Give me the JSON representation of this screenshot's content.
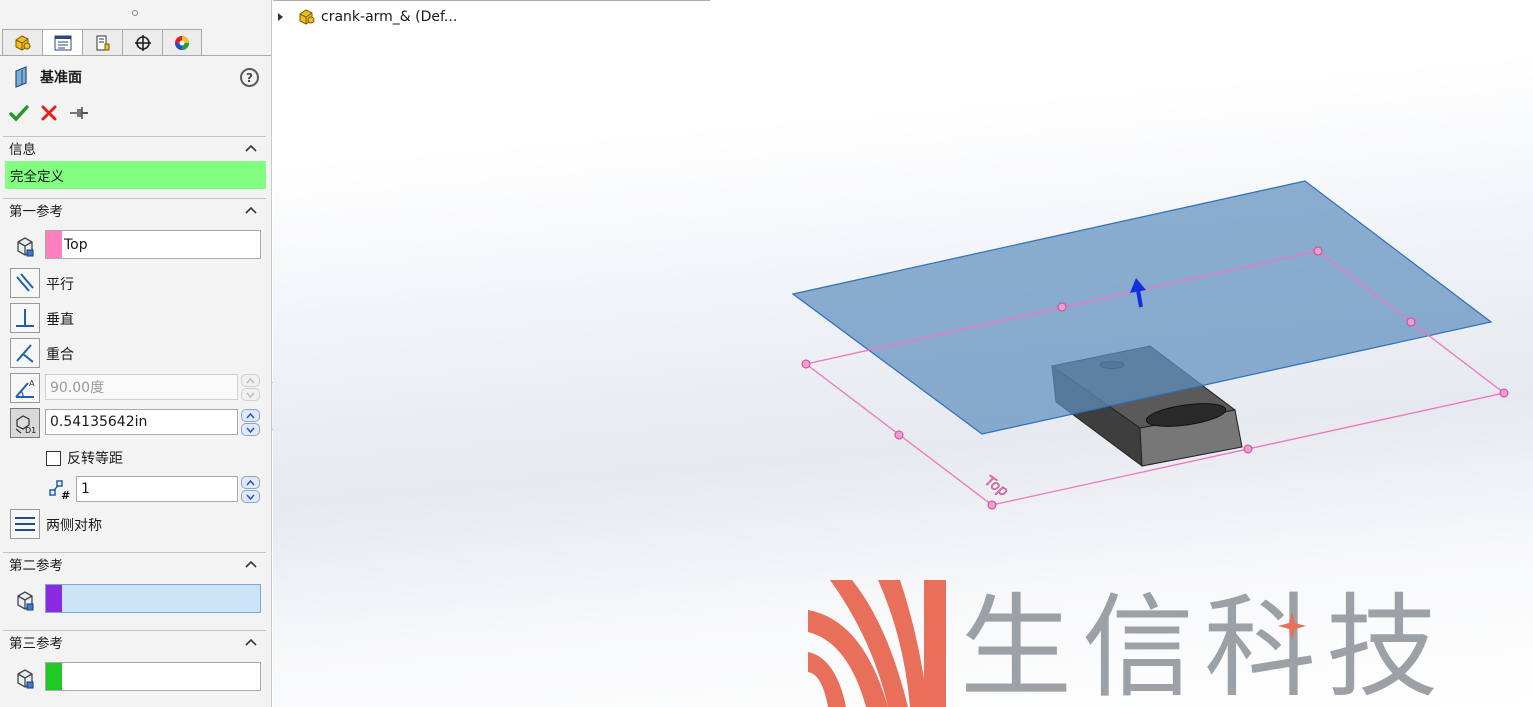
{
  "panel": {
    "tabs": [
      {
        "name": "feature-manager",
        "icon": "part-icon"
      },
      {
        "name": "property-manager",
        "icon": "property-list-icon",
        "active": true
      },
      {
        "name": "configuration-manager",
        "icon": "configuration-icon"
      },
      {
        "name": "dimxpert-manager",
        "icon": "crosshair-icon"
      },
      {
        "name": "display-manager",
        "icon": "color-wheel-icon"
      }
    ],
    "title": "基准面",
    "help_icon": "help-icon",
    "help_label": "?",
    "actions": [
      "ok-check-icon",
      "cancel-x-icon",
      "pushpin-icon"
    ],
    "info": {
      "header": "信息",
      "status": "完全定义",
      "status_color": "#82ff80"
    },
    "first_reference": {
      "header": "第一参考",
      "selection": "Top",
      "swatch_color": "#ff7fbf",
      "options": {
        "parallel": "平行",
        "perpendicular": "垂直",
        "coincident": "重合"
      },
      "angle_value": "90.00度",
      "offset_value": "0.54135642in",
      "flip_offset": "反转等距",
      "instances_value": "1",
      "mid_plane": "两侧对称"
    },
    "second_reference": {
      "header": "第二参考",
      "selection": "",
      "swatch_color": "#8a2be2"
    },
    "third_reference": {
      "header": "第三参考",
      "selection": "",
      "swatch_color": "#1fc926"
    }
  },
  "tree": {
    "root_label": "crank-arm_&  (Def...",
    "root_icon": "part-icon"
  },
  "scene": {
    "plane_label": "Top",
    "plane_fill": "#5f8fbe",
    "outline_color": "#f075c0",
    "arrow_color": "#1030e0"
  },
  "watermark": {
    "text": "生信科技",
    "accent_color": "#e8705a"
  }
}
